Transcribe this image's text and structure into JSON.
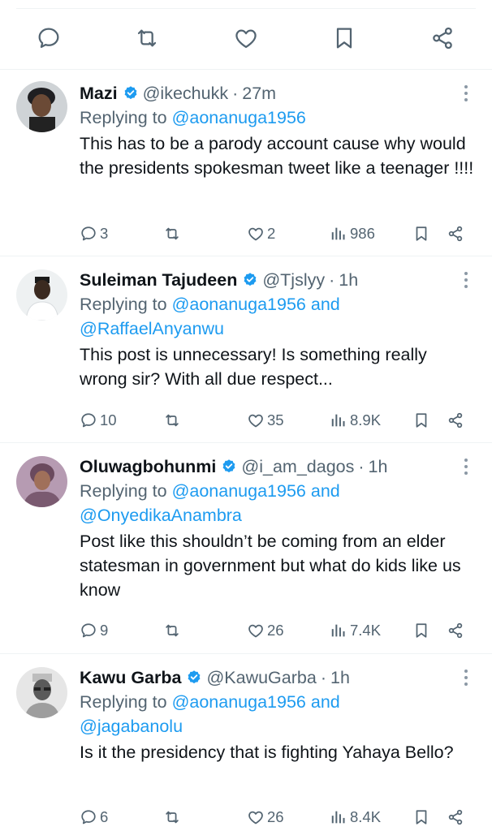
{
  "colors": {
    "accent": "#1d9bf0",
    "muted": "#536471",
    "text": "#0f1419",
    "divider": "#eff3f4"
  },
  "top_actions": [
    "reply-icon",
    "retweet-icon",
    "like-icon",
    "bookmark-icon",
    "share-icon"
  ],
  "replies": [
    {
      "name": "Mazi",
      "handle": "@ikechukk",
      "time": "27m",
      "replying_prefix": "Replying to",
      "mentions": [
        "@aonanuga1956"
      ],
      "mention_joiner": "and",
      "text": "This has to be a parody account cause why would the presidents spokesman tweet like a teenager !!!!",
      "replies_count": "3",
      "retweets_count": "",
      "likes_count": "2",
      "views_count": "986"
    },
    {
      "name": "Suleiman Tajudeen",
      "handle": "@Tjslyy",
      "time": "1h",
      "replying_prefix": "Replying to",
      "mentions": [
        "@aonanuga1956",
        "@RaffaelAnyanwu"
      ],
      "mention_joiner": "and",
      "text": "This post is unnecessary! Is something really wrong sir? With all due respect...",
      "replies_count": "10",
      "retweets_count": "",
      "likes_count": "35",
      "views_count": "8.9K"
    },
    {
      "name": "Oluwagbohunmi",
      "handle": "@i_am_dagos",
      "time": "1h",
      "replying_prefix": "Replying to",
      "mentions": [
        "@aonanuga1956",
        "@OnyedikaAnambra"
      ],
      "mention_joiner": "and",
      "text": "Post like this shouldn’t be coming from an elder statesman in government but what do kids like us know",
      "replies_count": "9",
      "retweets_count": "",
      "likes_count": "26",
      "views_count": "7.4K"
    },
    {
      "name": "Kawu Garba",
      "handle": "@KawuGarba",
      "time": "1h",
      "replying_prefix": "Replying to",
      "mentions": [
        "@aonanuga1956",
        "@jagabanolu"
      ],
      "mention_joiner": "and",
      "text": "Is it the presidency that is fighting Yahaya Bello?",
      "replies_count": "6",
      "retweets_count": "",
      "likes_count": "26",
      "views_count": "8.4K"
    }
  ]
}
